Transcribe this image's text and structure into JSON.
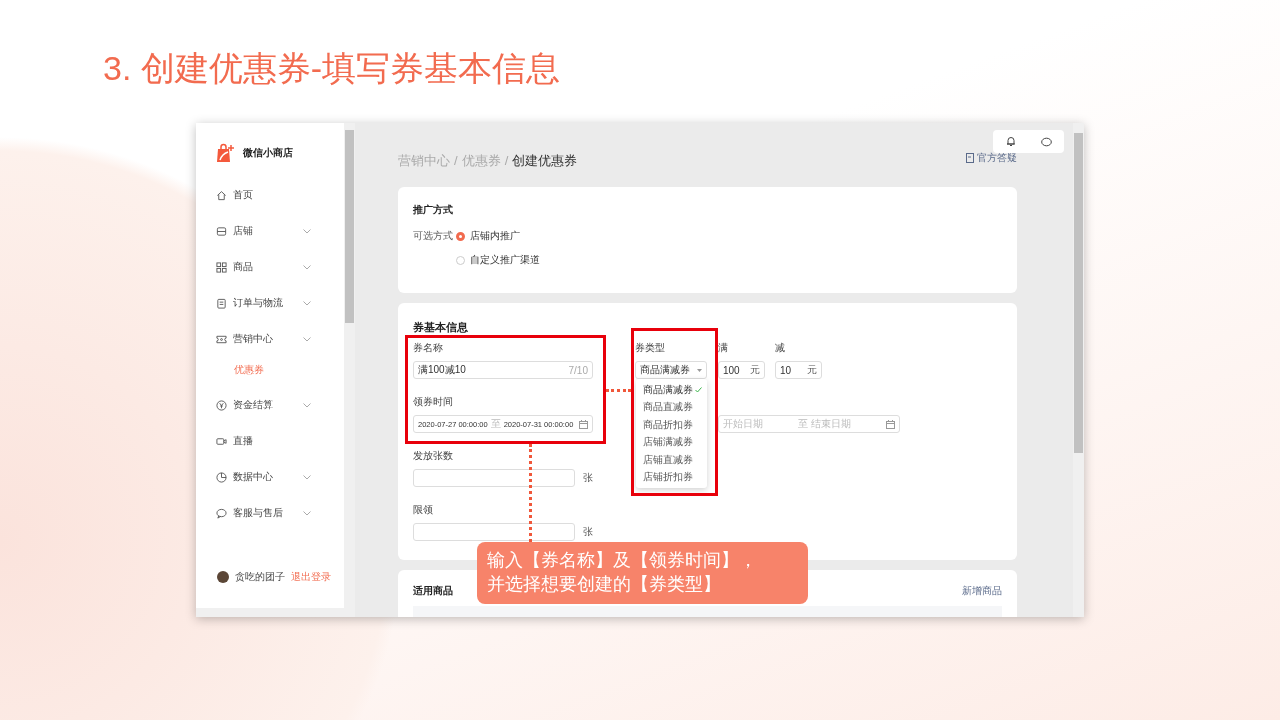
{
  "slide": {
    "title": "3. 创建优惠券-填写券基本信息"
  },
  "sidebar": {
    "brand": "微信小商店",
    "items": [
      {
        "label": "首页",
        "kind": "link",
        "selected": false
      },
      {
        "label": "店铺",
        "kind": "group",
        "selected": false
      },
      {
        "label": "商品",
        "kind": "group",
        "selected": false
      },
      {
        "label": "订单与物流",
        "kind": "group",
        "selected": false
      },
      {
        "label": "营销中心",
        "kind": "group",
        "selected": false,
        "children": [
          {
            "label": "优惠券",
            "selected": true
          }
        ]
      },
      {
        "label": "资金结算",
        "kind": "group",
        "selected": false
      },
      {
        "label": "直播",
        "kind": "link",
        "selected": false
      },
      {
        "label": "数据中心",
        "kind": "group",
        "selected": false
      },
      {
        "label": "客服与售后",
        "kind": "group",
        "selected": false
      }
    ],
    "user": {
      "name": "贪吃的团子",
      "logout": "退出登录"
    }
  },
  "header": {
    "separator": "/",
    "breadcrumb": [
      "营销中心",
      "优惠券",
      "创建优惠券"
    ],
    "help_link": "官方答疑"
  },
  "promotion": {
    "title": "推广方式",
    "label": "可选方式",
    "options": [
      {
        "label": "店铺内推广",
        "selected": true
      },
      {
        "label": "自定义推广渠道",
        "selected": false
      }
    ]
  },
  "basic_info": {
    "title": "券基本信息",
    "coupon_name": {
      "label": "券名称",
      "value": "满100减10",
      "counter": "7/10"
    },
    "claim_time": {
      "label": "领券时间",
      "start": "2020-07-27 00:00:00",
      "separator": "至",
      "end": "2020-07-31 00:00:00"
    },
    "quantity": {
      "label": "发放张数",
      "unit": "张"
    },
    "limit": {
      "label": "限领",
      "unit": "张"
    },
    "coupon_type": {
      "label": "券类型",
      "value": "商品满减券",
      "options": [
        {
          "label": "商品满减券",
          "selected": true
        },
        {
          "label": "商品直减券",
          "selected": false
        },
        {
          "label": "商品折扣券",
          "selected": false
        },
        {
          "label": "店铺满减券",
          "selected": false
        },
        {
          "label": "店铺直减券",
          "selected": false
        },
        {
          "label": "店铺折扣券",
          "selected": false
        }
      ]
    },
    "threshold": {
      "label": "满",
      "value": "100",
      "unit": "元"
    },
    "discount": {
      "label": "减",
      "value": "10",
      "unit": "元"
    },
    "use_time": {
      "start_placeholder": "开始日期",
      "separator": "至",
      "end_placeholder": "结束日期"
    }
  },
  "products": {
    "title": "适用商品",
    "add_link": "新增商品"
  },
  "callout": {
    "lines": [
      "输入【券名称】及【领券时间】，",
      "并选择想要创建的【券类型】"
    ]
  }
}
